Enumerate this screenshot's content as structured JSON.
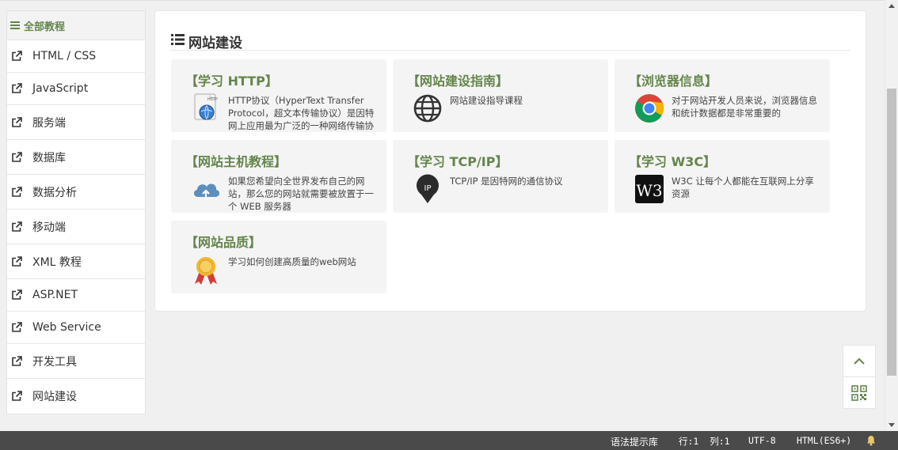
{
  "sidebar": {
    "header": "全部教程",
    "items": [
      {
        "label": "HTML / CSS"
      },
      {
        "label": "JavaScript"
      },
      {
        "label": "服务端"
      },
      {
        "label": "数据库"
      },
      {
        "label": "数据分析"
      },
      {
        "label": "移动端"
      },
      {
        "label": "XML 教程"
      },
      {
        "label": "ASP.NET"
      },
      {
        "label": "Web Service"
      },
      {
        "label": "开发工具"
      },
      {
        "label": "网站建设"
      }
    ]
  },
  "main": {
    "title": "网站建设",
    "cards": [
      {
        "title": "【学习 HTTP】",
        "desc": "HTTP协议（HyperText Transfer Protocol，超文本传输协议）是因特网上应用最为广泛的一种网络传输协议",
        "icon": "http-icon"
      },
      {
        "title": "【网站建设指南】",
        "desc": "网站建设指导课程",
        "icon": "globe-icon"
      },
      {
        "title": "【浏览器信息】",
        "desc": "对于网站开发人员来说，浏览器信息和统计数据都是非常重要的",
        "icon": "chrome-icon"
      },
      {
        "title": "【网站主机教程】",
        "desc": "如果您希望向全世界发布自己的网站，那么您的网站就需要被放置于一个 WEB 服务器",
        "icon": "cloud-upload-icon"
      },
      {
        "title": "【学习 TCP/IP】",
        "desc": "TCP/IP 是因特网的通信协议",
        "icon": "ip-pin-icon"
      },
      {
        "title": "【学习 W3C】",
        "desc": "W3C 让每个人都能在互联网上分享资源",
        "icon": "w3c-icon"
      },
      {
        "title": "【网站品质】",
        "desc": "学习如何创建高质量的web网站",
        "icon": "award-ribbon-icon"
      }
    ]
  },
  "statusbar": {
    "syntax_hint": "语法提示库",
    "row_col": "行:1  列:1",
    "encoding": "UTF-8",
    "language": "HTML(ES6+)"
  },
  "colors": {
    "accent": "#64854c",
    "statusbar_bg": "#4a4a4a",
    "card_bg": "#f4f4f4"
  }
}
